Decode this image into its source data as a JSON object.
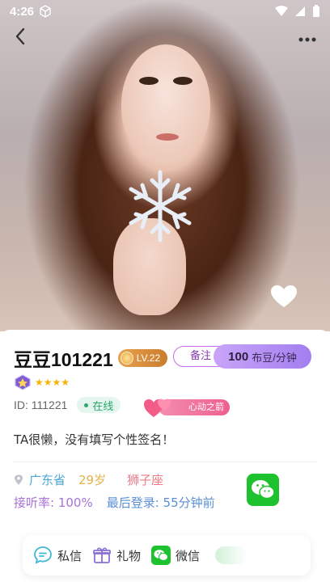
{
  "status_bar": {
    "time": "4:26"
  },
  "header": {
    "back_icon": "chevron-left-icon",
    "more_icon": "more-dots-icon"
  },
  "profile": {
    "name": "豆豆101221",
    "level": "LV.22",
    "remark_label": "备注",
    "price_amount": "100",
    "price_unit": "布豆/分钟",
    "stars": "★★★★",
    "uid": "ID: 111221",
    "online_label": "在线",
    "heart_tag": "心动之箭",
    "signature": "TA很懒，没有填写个性签名！",
    "province": "广东省",
    "age": "29岁",
    "zodiac": "狮子座",
    "answer_rate": "接听率: 100%",
    "last_login": "最后登录: 55分钟前"
  },
  "actions": [
    {
      "label": "私信",
      "icon": "message-icon"
    },
    {
      "label": "礼物",
      "icon": "gift-icon"
    },
    {
      "label": "微信",
      "icon": "wechat-icon"
    }
  ],
  "colors": {
    "accent_purple": "#a27ff0",
    "online_green": "#2da66b",
    "wechat_green": "#1ec22f",
    "level_orange": "#e9a24f"
  }
}
